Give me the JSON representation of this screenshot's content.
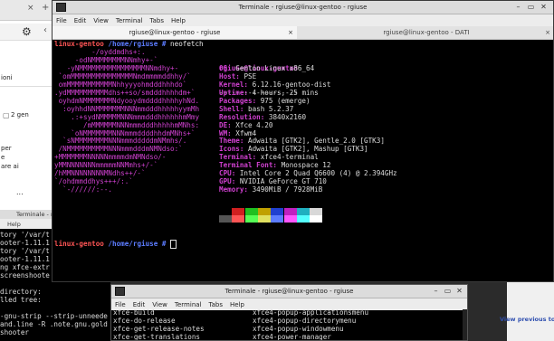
{
  "main_terminal": {
    "title": "Terminale - rgiuse@linux-gentoo - rgiuse",
    "menu": [
      "File",
      "Edit",
      "View",
      "Terminal",
      "Tabs",
      "Help"
    ],
    "tabs": [
      {
        "label": "rgiuse@linux-gentoo - rgiuse",
        "close": "×"
      },
      {
        "label": "rgiuse@linux-gentoo - DATI",
        "close": "×"
      }
    ],
    "prompt_host": "linux-gentoo",
    "prompt_path": "/home/rgiuse #",
    "command": "neofetch",
    "logo": [
      "         -/oyddmdhs+:.",
      "     -odNMMMMMMMMNNmhy+-`",
      "   -yNMMMMMMMMMMMMMMMMNNmdhy+-",
      " `omMMMMMMMMMMMMMMMNmdmmmmddhhy/`",
      " omMMMMMMMMMMMNhhyyyohmdddhhhdo`",
      ".ydMMMMMMMMMMdhs++so/smdddhhhhdm+`",
      " oyhdmNMMMMMMMNdyooydmddddhhhhyhNd.",
      "  :oyhhdNNMMMMMMMNNNmmdddhhhhhyymMh",
      "    .:+sydNMMMMMNNNmmmdddhhhhhhmMmy",
      "       /mMMMMMMNNNmmmdddhhhhhmMNhs:",
      "    `oNMMMMMMMNNNmmmddddhhdmMNhs+`",
      "  `sNMMMMMMMMNNNmmmdddddmNMmhs/.",
      " /NMMMMMMMMMMNNNmmmdddmNMNdso:`",
      "+MMMMMMMNNNNNmmmmdmNMNdso/-",
      "yMMNNNNNNNmmmmmNNMmhs+/-`",
      "/hMMNNNNNNNNMNdhs++/-`",
      "`/ohdmmddhys+++/:.`",
      "  `-//////:--."
    ],
    "username": "rgiuse@linux-gentoo",
    "separator": "-------------------",
    "info": [
      {
        "key": "OS",
        "value": "Gentoo Linux x86_64"
      },
      {
        "key": "Host",
        "value": "PSE"
      },
      {
        "key": "Kernel",
        "value": "6.12.16-gentoo-dist"
      },
      {
        "key": "Uptime",
        "value": "4 hours, 25 mins"
      },
      {
        "key": "Packages",
        "value": "975 (emerge)"
      },
      {
        "key": "Shell",
        "value": "bash 5.2.37"
      },
      {
        "key": "Resolution",
        "value": "3840x2160"
      },
      {
        "key": "DE",
        "value": "Xfce 4.20"
      },
      {
        "key": "WM",
        "value": "Xfwm4"
      },
      {
        "key": "Theme",
        "value": "Adwaita [GTK2], Gentle_2.0 [GTK3]"
      },
      {
        "key": "Icons",
        "value": "Adwaita [GTK2], Mashup [GTK3]"
      },
      {
        "key": "Terminal",
        "value": "xfce4-terminal"
      },
      {
        "key": "Terminal Font",
        "value": "Monospace 12"
      },
      {
        "key": "CPU",
        "value": "Intel Core 2 Quad Q6600 (4) @ 2.394GHz"
      },
      {
        "key": "GPU",
        "value": "NVIDIA GeForce GT 710"
      },
      {
        "key": "Memory",
        "value": "3490MiB / 7928MiB"
      }
    ],
    "palette_top": [
      "#000000",
      "#d02020",
      "#20c020",
      "#c0a000",
      "#2040d0",
      "#c020c0",
      "#20b0c0",
      "#d8d8d8"
    ],
    "palette_bottom": [
      "#555555",
      "#ff5555",
      "#55ff55",
      "#e0e060",
      "#5c7cff",
      "#ff55ff",
      "#55ffff",
      "#ffffff"
    ],
    "prompt2_host": "linux-gentoo",
    "prompt2_path": "/home/rgiuse #"
  },
  "second_terminal": {
    "title": "Terminale - rgiuse@linux-gentoo - rgiuse",
    "menu": [
      "File",
      "Edit",
      "View",
      "Terminal",
      "Tabs",
      "Help"
    ],
    "col1": [
      "xfce-build",
      "xfce-do-release",
      "xfce-get-release-notes",
      "xfce-get-translations"
    ],
    "col2": [
      "xfce4-popup-applicationsmenu",
      "xfce4-popup-directorymenu",
      "xfce4-popup-windowmenu",
      "xfce4-power-manager"
    ]
  },
  "left_terminal": {
    "title": "Terminale - rgiuse",
    "menu_item": "Help",
    "lines": [
      "tory '/var/t",
      "ooter-1.11.1",
      "tory '/var/t",
      "ooter-1.11.1",
      "ng xfce-extr",
      "screenshoote",
      "",
      "directory:",
      "lled tree:",
      "",
      "-gnu-strip --strip-unneede",
      "and.line -R .note.gnu.gold",
      "shooter"
    ]
  },
  "browser": {
    "tab_close": "×",
    "plus": "+",
    "snippet_1": "ioni",
    "snippet_2": "2 gen",
    "snippet_3": "per",
    "snippet_4": "e",
    "snippet_5": "are ai",
    "more": "...",
    "right_link": "View previous topic :: Vi"
  }
}
